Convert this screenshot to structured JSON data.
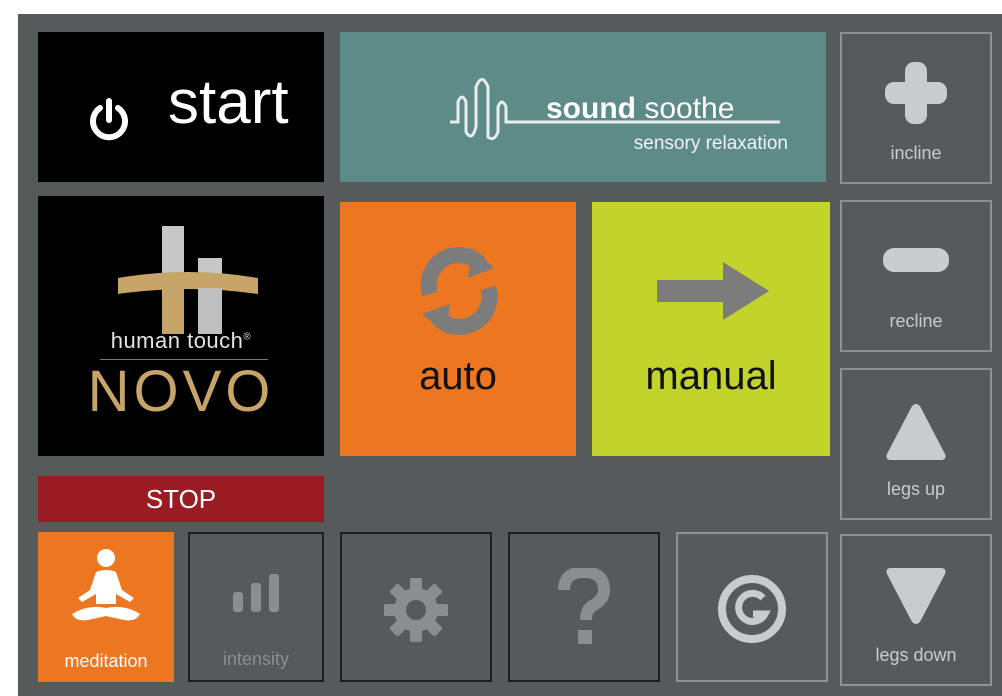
{
  "start": {
    "label": "start",
    "icon": "power-icon"
  },
  "logo": {
    "brand_name": "human touch",
    "registered": "®",
    "model": "NOVO"
  },
  "stop": {
    "label": "STOP"
  },
  "sound_soothe": {
    "title_bold": "sound",
    "title_rest": " soothe",
    "subtitle": "sensory relaxation",
    "icon": "sound-wave-icon"
  },
  "auto": {
    "label": "auto",
    "icon": "refresh-icon",
    "color": "#ed7621"
  },
  "manual": {
    "label": "manual",
    "icon": "arrow-right-icon",
    "color": "#c2d42b"
  },
  "side": {
    "incline": {
      "label": "incline",
      "icon": "plus-icon"
    },
    "recline": {
      "label": "recline",
      "icon": "minus-icon"
    },
    "legs_up": {
      "label": "legs up",
      "icon": "triangle-up-icon"
    },
    "legs_down": {
      "label": "legs down",
      "icon": "triangle-down-icon"
    }
  },
  "bottom": {
    "meditation": {
      "label": "meditation",
      "icon": "meditation-icon"
    },
    "intensity": {
      "label": "intensity",
      "icon": "intensity-bars-icon"
    },
    "settings": {
      "icon": "gear-icon"
    },
    "help": {
      "icon": "question-icon"
    },
    "g_mode": {
      "icon": "g-circle-icon"
    }
  },
  "colors": {
    "background": "#565a5b",
    "stop": "#9b1b24",
    "soothe": "#5e8a88",
    "gold": "#c7a468"
  }
}
